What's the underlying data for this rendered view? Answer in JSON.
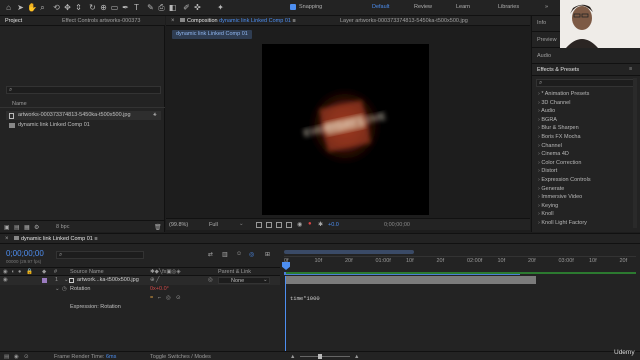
{
  "toolbar": {
    "snapping": "Snapping",
    "workspaces": [
      "Default",
      "Review",
      "Learn",
      "Libraries"
    ],
    "more": "»"
  },
  "project_panel": {
    "tab": "Project",
    "effect_controls_tab": "Effect Controls artworks-000373",
    "name_header": "Name",
    "items": [
      {
        "name": "artworks-000373374813-5450ka-t500x500.jpg",
        "icon": "image-icon"
      },
      {
        "name": "dynamic link Linked Comp 01",
        "icon": "composition-icon"
      }
    ],
    "bpc": "8 bpc"
  },
  "composition": {
    "tab_prefix": "Composition",
    "tab_name": "dynamic link Linked Comp 01",
    "layer_tab": "Layer artworks-000373374813-5450ka-t500x500.jpg",
    "breadcrumb": "dynamic link Linked Comp 01",
    "canvas_text": "EVERYDAY LOVE",
    "zoom": "(99.8%)",
    "resolution": "Full",
    "exposure": "+0.0",
    "timecode": "0;00;00;00"
  },
  "right_panels": {
    "info": "Info",
    "preview": "Preview",
    "audio": "Audio",
    "effects_presets": "Effects & Presets",
    "search_placeholder": "",
    "effects": [
      "* Animation Presets",
      "3D Channel",
      "Audio",
      "BGRA",
      "Blur & Sharpen",
      "Boris FX Mocha",
      "Channel",
      "Cinema 4D",
      "Color Correction",
      "Distort",
      "Expression Controls",
      "Generate",
      "Immersive Video",
      "Keying",
      "Knoll",
      "Knoll Light Factory"
    ]
  },
  "timeline": {
    "tab": "dynamic link Linked Comp 01",
    "timecode": "0;00;00;00",
    "fps": "00000 (29.97 fps)",
    "col_source": "Source Name",
    "col_parent": "Parent & Link",
    "layer": {
      "number": "1",
      "name": "artwork...ka-t500x500.jpg",
      "parent": "None"
    },
    "rotation": {
      "label": "Rotation",
      "value": "0x+0.0°"
    },
    "expression_label": "Expression: Rotation",
    "expression_code": "time*1000",
    "ruler": [
      "0f",
      "10f",
      "20f",
      "01:00f",
      "10f",
      "20f",
      "02:00f",
      "10f",
      "20f",
      "03:00f",
      "10f",
      "20f"
    ],
    "render_time_label": "Frame Render Time:",
    "render_time_value": "6ms",
    "toggle": "Toggle Switches / Modes"
  },
  "watermark": "Udemy"
}
